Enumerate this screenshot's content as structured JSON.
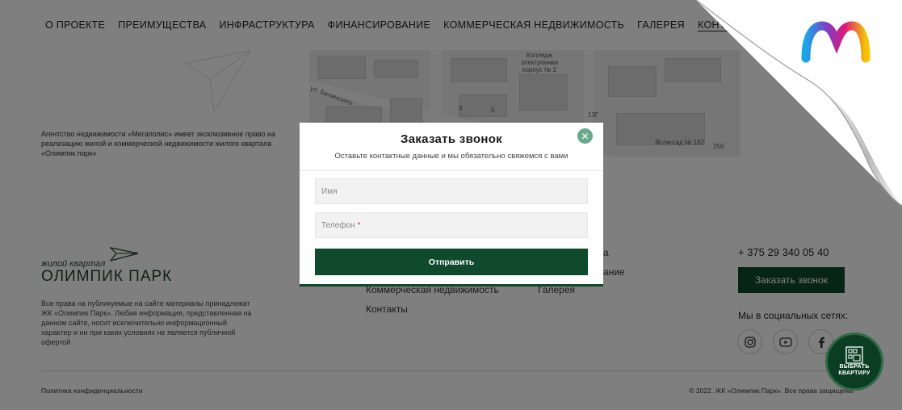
{
  "nav": {
    "items": [
      "О ПРОЕКТЕ",
      "ПРЕИМУЩЕСТВА",
      "ИНФРАСТРУКТУРА",
      "ФИНАНСИРОВАНИЕ",
      "КОММЕРЧЕСКАЯ НЕДВИЖИМОСТЬ",
      "ГАЛЕРЕЯ",
      "КОНТАКТ"
    ]
  },
  "agency_text": "Агентство недвижимости «Мегаполис» имеет эксклюзивное право на реализацию жилой и коммерческой недвижимости жилого квартала «Олимпик парк»",
  "map": {
    "street_label": "ул. Белинского",
    "college_label": "Колледж электроники корпус № 2",
    "kindergarten_label": "Ясли-сад № 162",
    "numbers": [
      "3",
      "5",
      "13Г",
      "25б",
      "1"
    ]
  },
  "logo": {
    "sub": "жилой квартал",
    "main": "ОЛИМПИК ПАРК"
  },
  "rights_text": "Все права на публикуемые на сайте материалы принадлежат ЖК «Олимпик Парк». Любая информация, представленная на данном сайте, носит исключительно информационный характер и ни при каких условиях не является публичной офертой",
  "footer": {
    "col1": [
      "Коммерческая недвижимость",
      "Контакты"
    ],
    "col2": [
      "Галерея"
    ],
    "col2_partial": [
      "а",
      "ание"
    ],
    "phone": "+ 375 29 340 05 40",
    "call_button": "Заказать звонок",
    "social_title": "Мы в социальных сетях:",
    "policy": "Политика конфиденциальности",
    "copyright": "© 2022. ЖК «Олимпик Парк». Все права защищены"
  },
  "choose_button": {
    "line1": "ВЫБРАТЬ",
    "line2": "КВАРТИРУ"
  },
  "modal": {
    "title": "Заказать звонок",
    "subtitle": "Оставьте контактные данные и мы обязательно свяжемся с вами",
    "name_placeholder": "Имя",
    "phone_placeholder": "Телефон",
    "required_mark": "*",
    "submit_label": "Отправить"
  },
  "colors": {
    "brand_green": "#0e4a2b",
    "close_button": "#6aa98d",
    "overlay": "rgba(0,0,0,0.5)"
  },
  "icons": [
    "instagram-icon",
    "youtube-icon",
    "facebook-icon",
    "close-icon",
    "paper-plane-icon",
    "building-icon"
  ]
}
